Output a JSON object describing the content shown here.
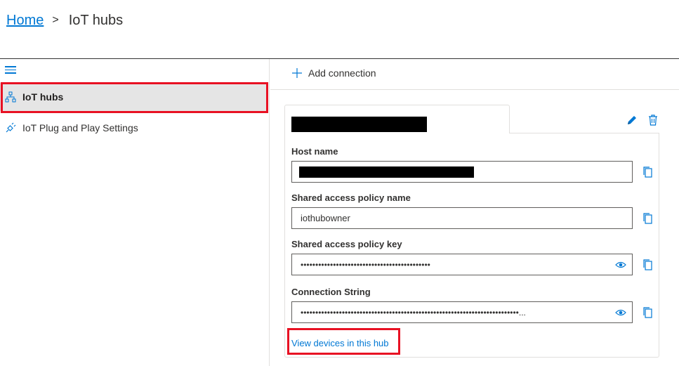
{
  "breadcrumb": {
    "home": "Home",
    "separator": ">",
    "current": "IoT hubs"
  },
  "sidebar": {
    "items": [
      {
        "label": "IoT hubs",
        "icon": "hub-hierarchy-icon",
        "selected": true
      },
      {
        "label": "IoT Plug and Play Settings",
        "icon": "plug-icon",
        "selected": false
      }
    ]
  },
  "commandbar": {
    "add_connection": "Add connection"
  },
  "connection": {
    "fields": [
      {
        "label": "Host name",
        "value": ""
      },
      {
        "label": "Shared access policy name",
        "value": "iothubowner"
      },
      {
        "label": "Shared access policy key",
        "value": "••••••••••••••••••••••••••••••••••••••••••••"
      },
      {
        "label": "Connection String",
        "value": "••••••••••••••••••••••••••••••••••••••••••••••••••••••••••••••••••••••••••..."
      }
    ],
    "view_devices": "View devices in this hub"
  },
  "colors": {
    "accent": "#0078d4",
    "highlight": "#e81123",
    "selected_bg": "#e5e5e5"
  }
}
